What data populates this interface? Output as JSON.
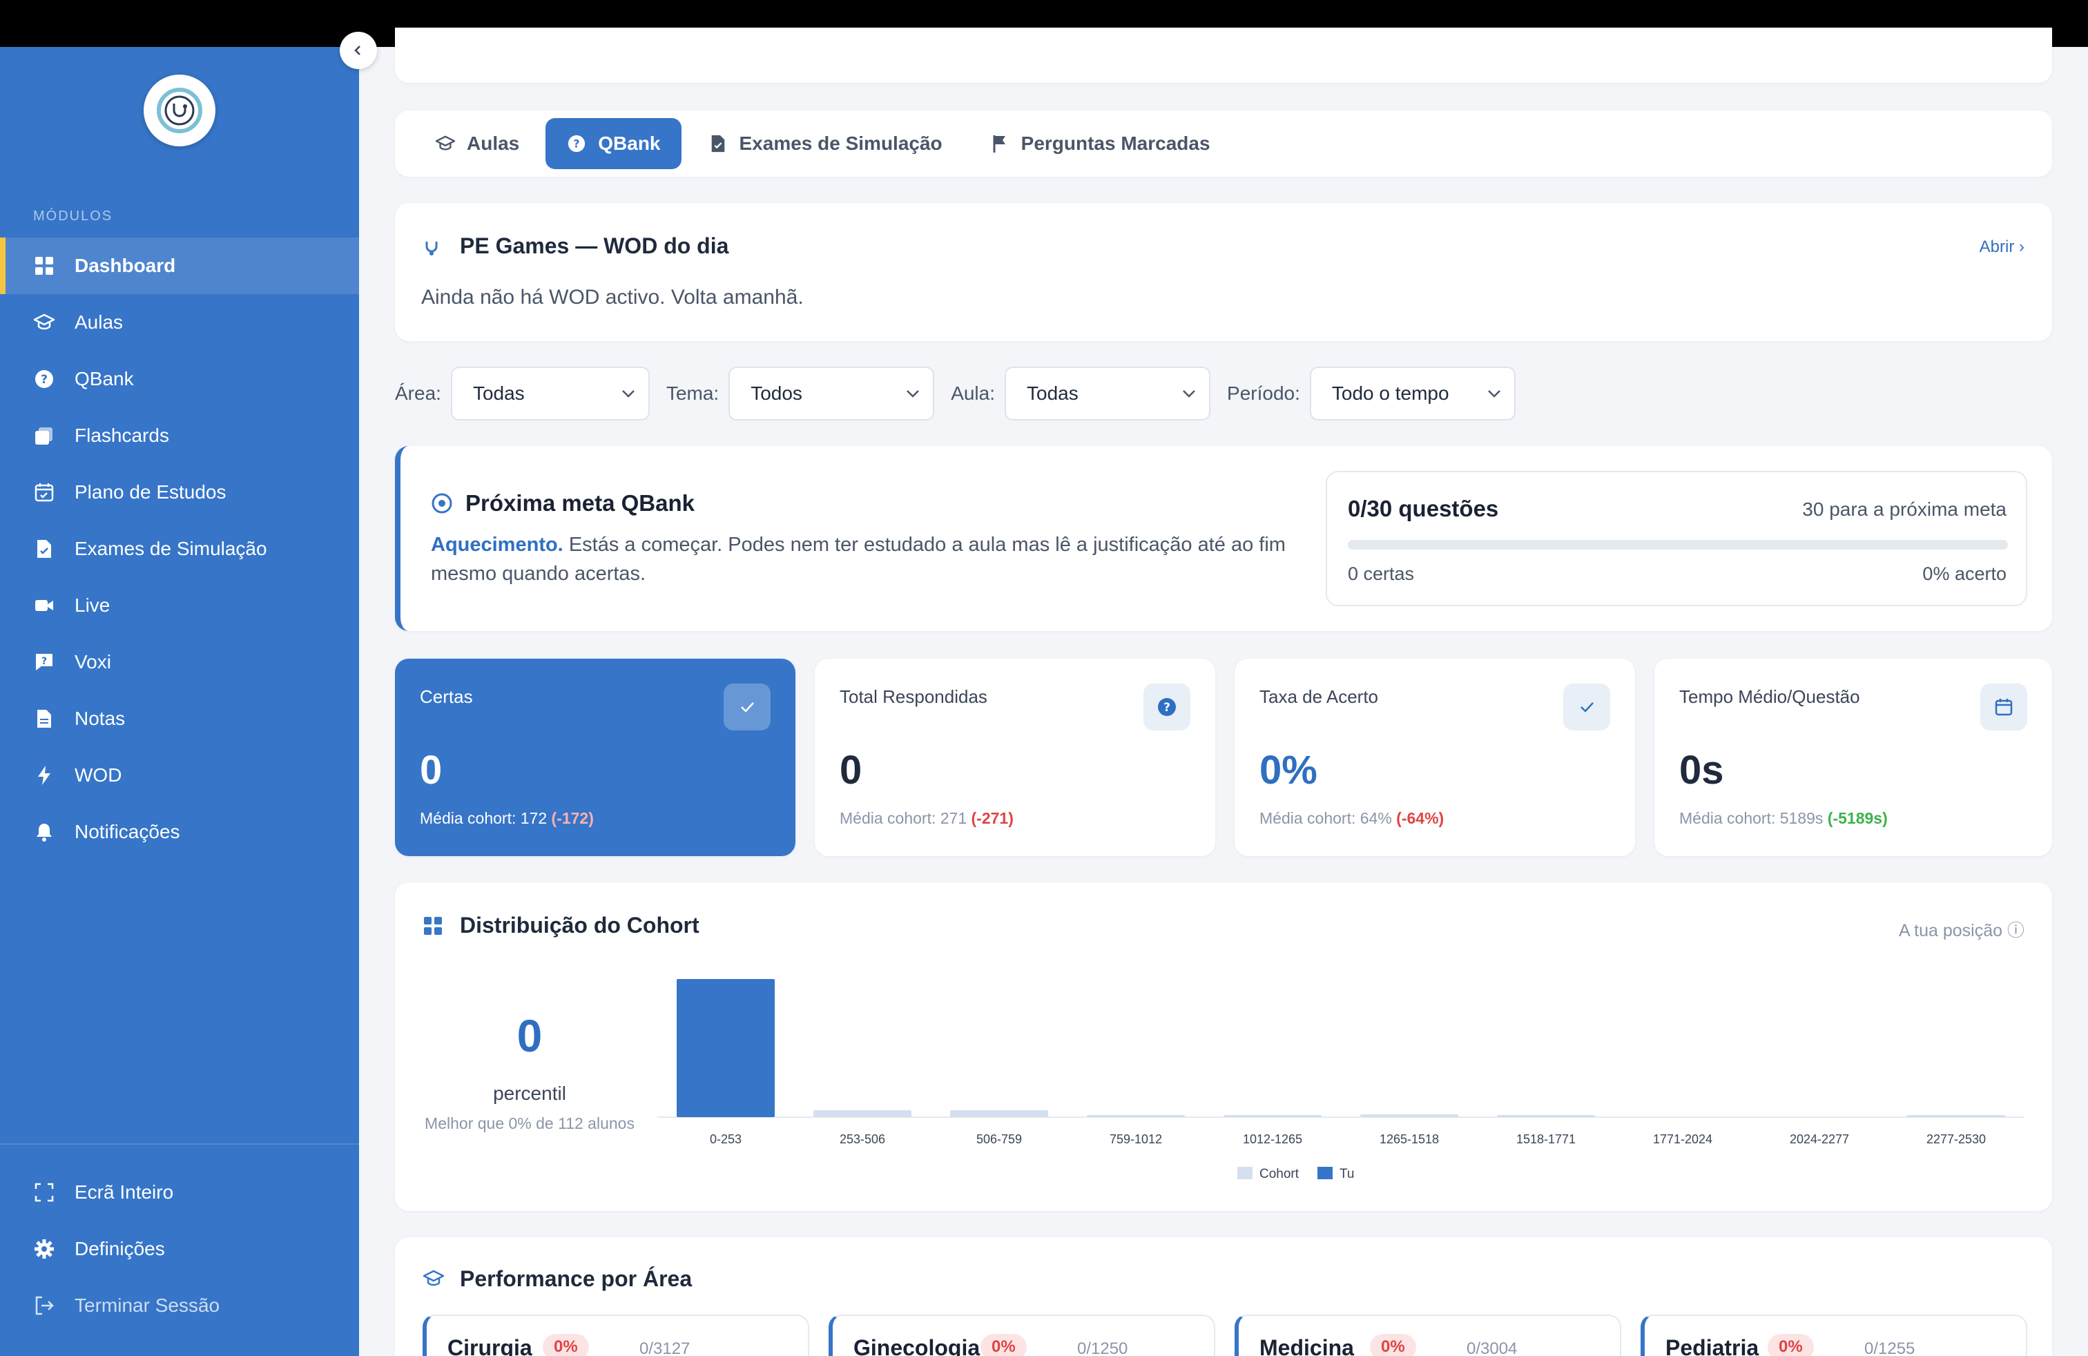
{
  "sidebar": {
    "section_label": "MÓDULOS",
    "items": [
      {
        "label": "Dashboard",
        "icon": "grid-icon"
      },
      {
        "label": "Aulas",
        "icon": "graduation-cap-icon"
      },
      {
        "label": "QBank",
        "icon": "question-circle-icon"
      },
      {
        "label": "Flashcards",
        "icon": "cards-icon"
      },
      {
        "label": "Plano de Estudos",
        "icon": "calendar-icon"
      },
      {
        "label": "Exames de Simulação",
        "icon": "document-check-icon"
      },
      {
        "label": "Live",
        "icon": "video-icon"
      },
      {
        "label": "Voxi",
        "icon": "chat-question-icon"
      },
      {
        "label": "Notas",
        "icon": "notes-icon"
      },
      {
        "label": "WOD",
        "icon": "bolt-icon"
      },
      {
        "label": "Notificações",
        "icon": "bell-icon"
      }
    ],
    "bottom": [
      {
        "label": "Ecrã Inteiro",
        "icon": "fullscreen-icon"
      },
      {
        "label": "Definições",
        "icon": "gear-icon"
      },
      {
        "label": "Terminar Sessão",
        "icon": "logout-icon"
      }
    ]
  },
  "tabs": [
    {
      "label": "Aulas",
      "icon": "graduation-cap-icon"
    },
    {
      "label": "QBank",
      "icon": "question-circle-icon"
    },
    {
      "label": "Exames de Simulação",
      "icon": "document-check-icon"
    },
    {
      "label": "Perguntas Marcadas",
      "icon": "flag-icon"
    }
  ],
  "wod": {
    "title": "PE Games — WOD do dia",
    "link": "Abrir ›",
    "message": "Ainda não há WOD activo. Volta amanhã."
  },
  "filters": {
    "area": {
      "label": "Área:",
      "value": "Todas"
    },
    "tema": {
      "label": "Tema:",
      "value": "Todos"
    },
    "aula": {
      "label": "Aula:",
      "value": "Todas"
    },
    "periodo": {
      "label": "Período:",
      "value": "Todo o tempo"
    }
  },
  "goal": {
    "title": "Próxima meta QBank",
    "level": "Aquecimento.",
    "description": "Estás a começar. Podes nem ter estudado a aula mas lê a justificação até ao fim mesmo quando acertas.",
    "count": "0/30 questões",
    "next": "30 para a próxima meta",
    "progress": 0,
    "correct": "0 certas",
    "rate": "0% acerto"
  },
  "stats": [
    {
      "title": "Certas",
      "value": "0",
      "sub": "Média cohort: 172",
      "delta": "(-172)",
      "icon": "check-icon"
    },
    {
      "title": "Total Respondidas",
      "value": "0",
      "sub": "Média cohort: 271",
      "delta": "(-271)",
      "icon": "question-circle-icon"
    },
    {
      "title": "Taxa de Acerto",
      "value": "0%",
      "sub": "Média cohort: 64%",
      "delta": "(-64%)",
      "icon": "check-icon"
    },
    {
      "title": "Tempo Médio/Questão",
      "value": "0s",
      "sub": "Média cohort: 5189s",
      "delta": "(-5189s)",
      "icon": "calendar-icon"
    }
  ],
  "distribution": {
    "title": "Distribuição do Cohort",
    "hint": "A tua posição ⓘ",
    "percentile": "0",
    "percentile_label": "percentil",
    "percentile_sub": "Melhor que 0% de 112 alunos"
  },
  "chart_data": {
    "type": "bar",
    "categories": [
      "0-253",
      "253-506",
      "506-759",
      "759-1012",
      "1012-1265",
      "1265-1518",
      "1518-1771",
      "1771-2024",
      "2024-2277",
      "2277-2530"
    ],
    "series": [
      {
        "name": "Cohort",
        "values": [
          0,
          5,
          5,
          1,
          1,
          2,
          1,
          0,
          0,
          1
        ]
      },
      {
        "name": "Tu",
        "values": [
          100,
          0,
          0,
          0,
          0,
          0,
          0,
          0,
          0,
          0
        ]
      }
    ],
    "ylim": [
      0,
      100
    ],
    "legend": "bottom-center",
    "colors": {
      "Cohort": "#d4e0ef",
      "Tu": "#3675c8"
    }
  },
  "performance": {
    "title": "Performance por Área",
    "areas": [
      {
        "name": "Cirurgia",
        "badge": "0%",
        "count": "0/3127"
      },
      {
        "name": "Ginecologia",
        "badge": "0%",
        "count": "0/1250"
      },
      {
        "name": "Medicina",
        "badge": "0%",
        "count": "0/3004"
      },
      {
        "name": "Pediatria",
        "badge": "0%",
        "count": "0/1255"
      }
    ]
  },
  "colors": {
    "primary": "#3675c8",
    "accent": "#f5c542",
    "negative": "#e04444",
    "positive": "#3bb34a"
  }
}
